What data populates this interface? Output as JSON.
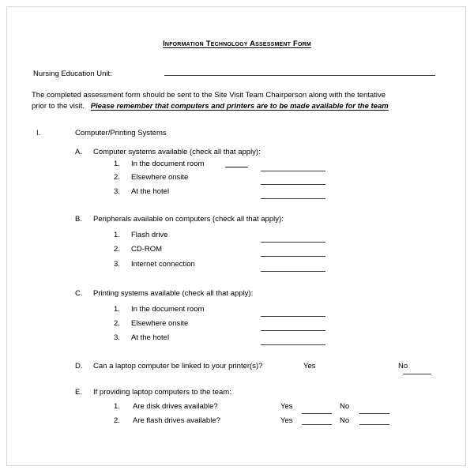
{
  "document": {
    "title": "Information Technology Assessment Form",
    "field_label": "Nursing Education Unit:",
    "intro_line1": "The completed assessment form should be sent to the Site Visit Team Chairperson along with the tentative",
    "intro_line2_plain": "prior to the visit.",
    "intro_line2_emphasis": "Please remember that computers and printers are to be made available for the team"
  },
  "section_I": {
    "numeral": "I.",
    "heading": "Computer/Printing Systems",
    "subsections": [
      {
        "letter": "A.",
        "heading": "Computer systems available (check all that apply):",
        "items": [
          {
            "num": "1.",
            "label": "In the document room"
          },
          {
            "num": "2.",
            "label": "Elsewhere onsite"
          },
          {
            "num": "3.",
            "label": "At the hotel"
          }
        ]
      },
      {
        "letter": "B.",
        "heading": "Peripherals  available on computers (check all that apply):",
        "items": [
          {
            "num": "1.",
            "label": "Flash drive"
          },
          {
            "num": "2.",
            "label": "CD-ROM"
          },
          {
            "num": "3.",
            "label": "Internet connection"
          }
        ]
      },
      {
        "letter": "C.",
        "heading": "Printing systems available (check all that apply):",
        "items": [
          {
            "num": "1.",
            "label": "In the document room"
          },
          {
            "num": "2.",
            "label": "Elsewhere onsite"
          },
          {
            "num": "3.",
            "label": "At the hotel"
          }
        ]
      },
      {
        "letter": "D.",
        "heading": "Can a laptop computer be linked to your printer(s)?",
        "yes_label": "Yes",
        "no_label": "No"
      },
      {
        "letter": "E.",
        "heading": "If providing laptop computers to the team:",
        "items": [
          {
            "num": "1.",
            "label": "Are disk drives available?",
            "yes_label": "Yes",
            "no_label": "No"
          },
          {
            "num": "2.",
            "label": "Are flash drives available?",
            "yes_label": "Yes",
            "no_label": "No"
          }
        ]
      }
    ]
  },
  "colors": {
    "page_background": "#ffffff",
    "text": "#000000",
    "rule": "#3a3a3a",
    "border": "#d6d6d6"
  }
}
